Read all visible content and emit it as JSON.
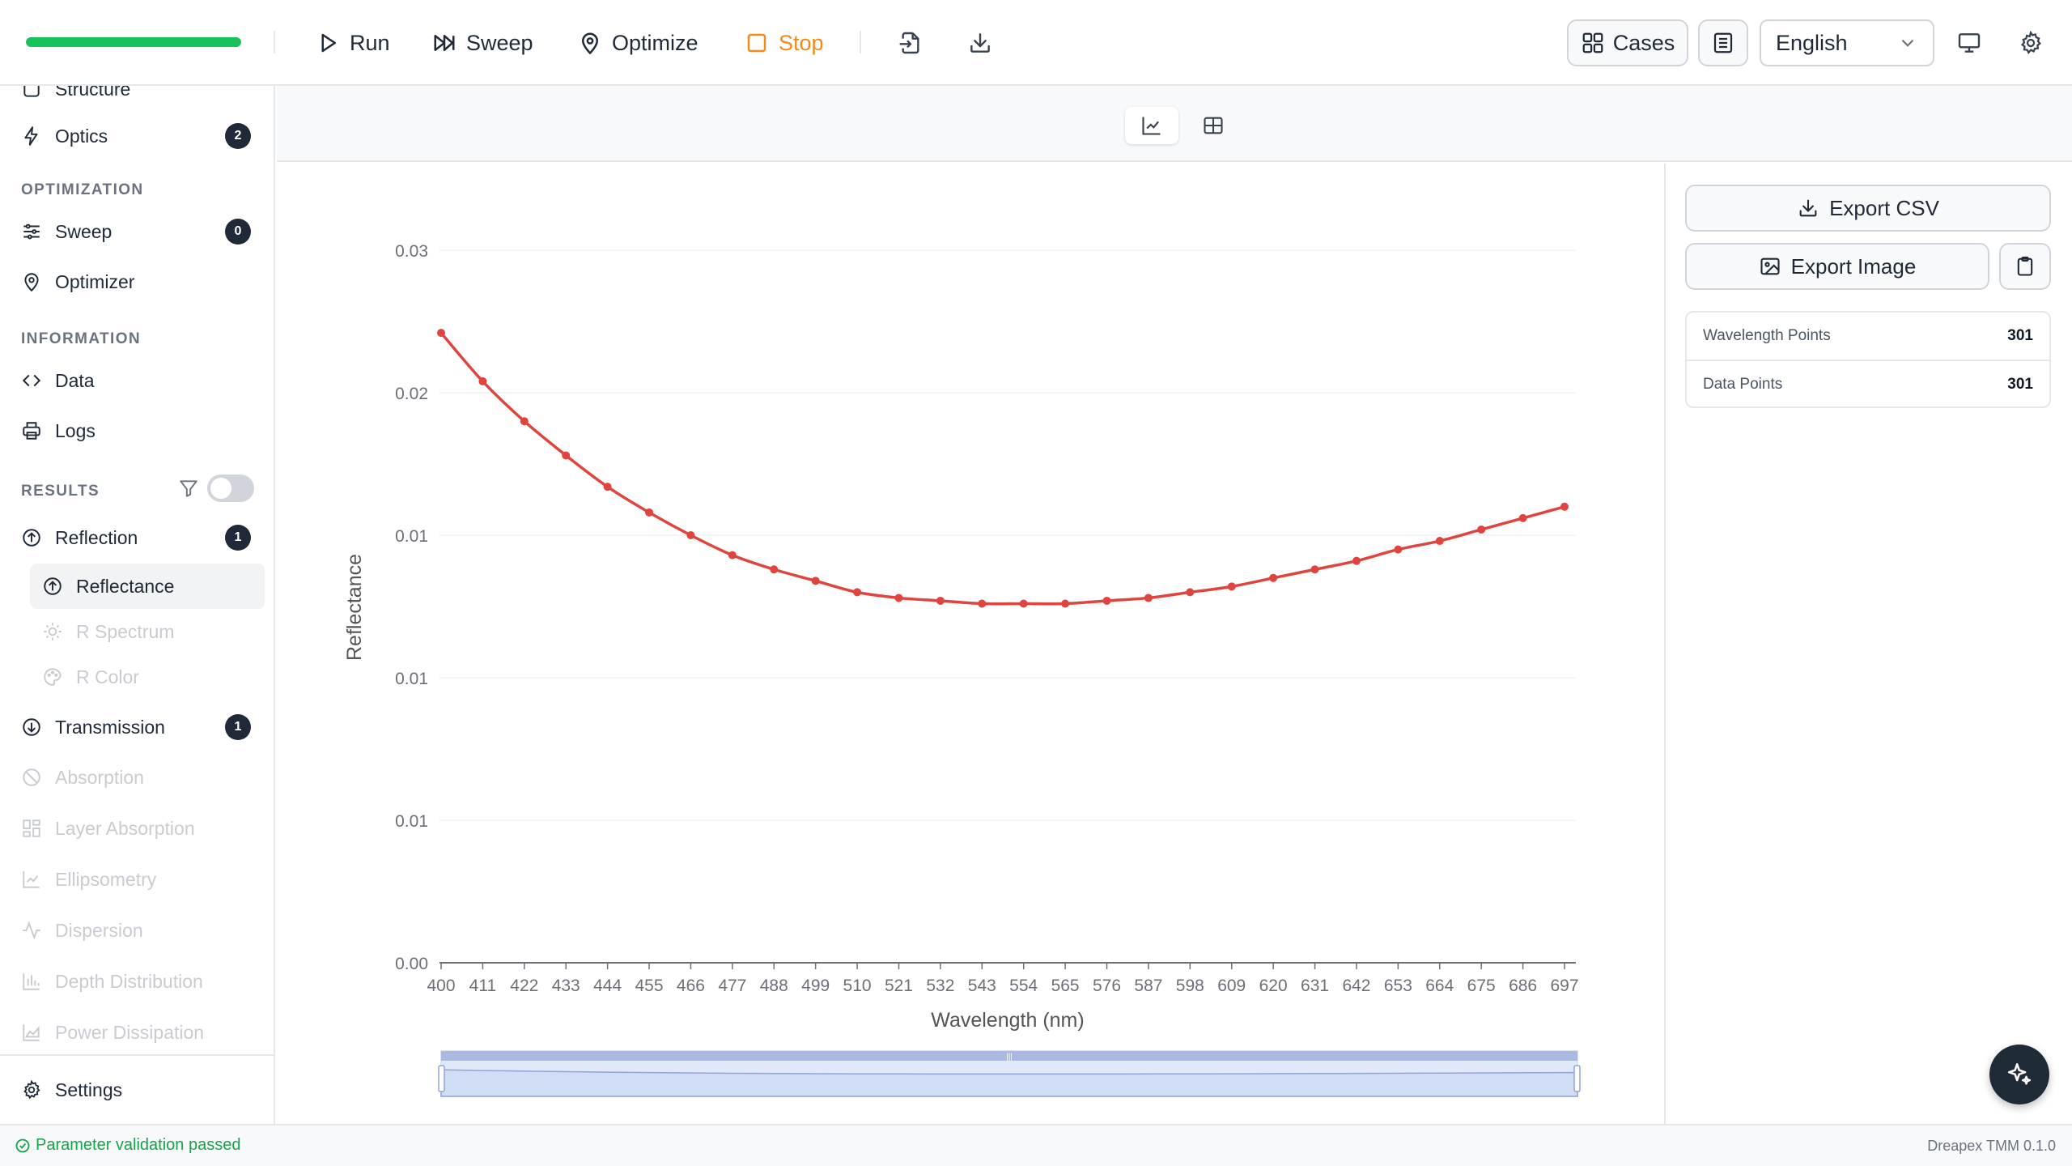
{
  "toolbar": {
    "progress_fraction": 1.0,
    "run_label": "Run",
    "sweep_label": "Sweep",
    "optimize_label": "Optimize",
    "stop_label": "Stop",
    "cases_label": "Cases",
    "language": "English"
  },
  "sidebar": {
    "partial_item": "Structure",
    "optics": {
      "label": "Optics",
      "badge": "2"
    },
    "section_optimization": "OPTIMIZATION",
    "sweep": {
      "label": "Sweep",
      "badge": "0"
    },
    "optimizer": {
      "label": "Optimizer"
    },
    "section_information": "INFORMATION",
    "data": {
      "label": "Data"
    },
    "logs": {
      "label": "Logs"
    },
    "section_results": "RESULTS",
    "reflection": {
      "label": "Reflection",
      "badge": "1"
    },
    "reflectance": {
      "label": "Reflectance"
    },
    "r_spectrum": {
      "label": "R Spectrum"
    },
    "r_color": {
      "label": "R Color"
    },
    "transmission": {
      "label": "Transmission",
      "badge": "1"
    },
    "absorption": {
      "label": "Absorption"
    },
    "layer_absorption": {
      "label": "Layer Absorption"
    },
    "ellipsometry": {
      "label": "Ellipsometry"
    },
    "dispersion": {
      "label": "Dispersion"
    },
    "depth_distribution": {
      "label": "Depth Distribution"
    },
    "power_dissipation": {
      "label": "Power Dissipation"
    },
    "settings": {
      "label": "Settings"
    }
  },
  "right_panel": {
    "export_csv": "Export CSV",
    "export_image": "Export Image",
    "stats": [
      {
        "label": "Wavelength Points",
        "value": "301"
      },
      {
        "label": "Data Points",
        "value": "301"
      }
    ]
  },
  "status": {
    "message": "Parameter validation passed",
    "version": "Dreapex TMM 0.1.0"
  },
  "chart_data": {
    "type": "line",
    "title": "",
    "xlabel": "Wavelength (nm)",
    "ylabel": "Reflectance",
    "x": [
      400,
      411,
      422,
      433,
      444,
      455,
      466,
      477,
      488,
      499,
      510,
      521,
      532,
      543,
      554,
      565,
      576,
      587,
      598,
      609,
      620,
      631,
      642,
      653,
      664,
      675,
      686,
      697
    ],
    "y_tick_labels": [
      "0.00",
      "0.01",
      "0.01",
      "0.01",
      "0.02",
      "0.03"
    ],
    "ylim": [
      0,
      0.025
    ],
    "series": [
      {
        "values": [
          0.0221,
          0.0204,
          0.019,
          0.0178,
          0.0167,
          0.0158,
          0.015,
          0.0143,
          0.0138,
          0.0134,
          0.013,
          0.0128,
          0.0127,
          0.0126,
          0.0126,
          0.0126,
          0.0127,
          0.0128,
          0.013,
          0.0132,
          0.0135,
          0.0138,
          0.0141,
          0.0145,
          0.0148,
          0.0152,
          0.0156,
          0.016
        ],
        "color": "#e0443e"
      }
    ],
    "grid": true,
    "data_zoom": true
  },
  "colors": {
    "accent_green": "#16c25a",
    "stop_orange": "#f28a1b",
    "series_red": "#e0443e"
  }
}
